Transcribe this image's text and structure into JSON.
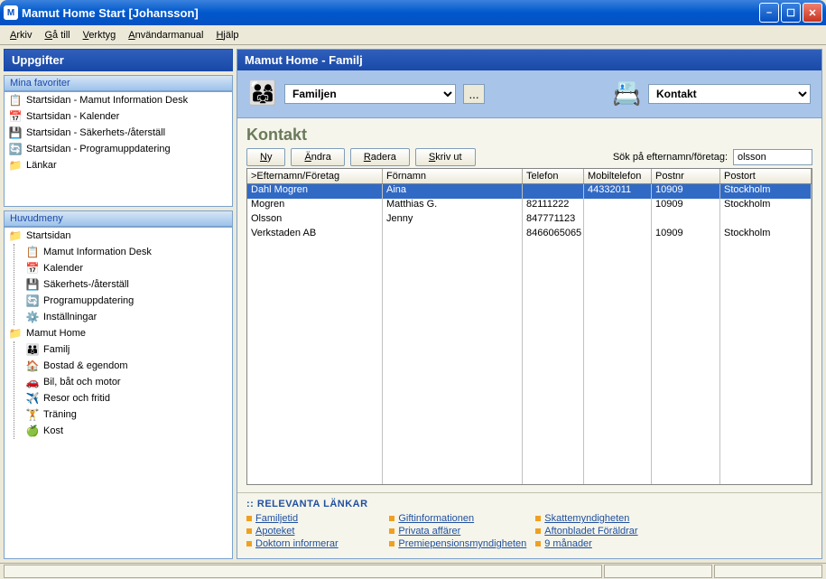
{
  "window": {
    "title": "Mamut Home Start  [Johansson]"
  },
  "menubar": [
    "Arkiv",
    "Gå till",
    "Verktyg",
    "Användarmanual",
    "Hjälp"
  ],
  "left": {
    "title": "Uppgifter",
    "favorites": {
      "header": "Mina favoriter",
      "items": [
        {
          "icon": "info",
          "label": "Startsidan - Mamut Information Desk"
        },
        {
          "icon": "calendar",
          "label": "Startsidan - Kalender"
        },
        {
          "icon": "disk",
          "label": "Startsidan - Säkerhets-/återställ"
        },
        {
          "icon": "arrow",
          "label": "Startsidan - Programuppdatering"
        },
        {
          "icon": "folder",
          "label": "Länkar"
        }
      ]
    },
    "mainmenu": {
      "header": "Huvudmeny",
      "nodes": [
        {
          "icon": "folder",
          "label": "Startsidan",
          "children": [
            {
              "icon": "info",
              "label": "Mamut Information Desk"
            },
            {
              "icon": "calendar",
              "label": "Kalender"
            },
            {
              "icon": "disk",
              "label": "Säkerhets-/återställ"
            },
            {
              "icon": "arrow",
              "label": "Programuppdatering"
            },
            {
              "icon": "gear",
              "label": "Inställningar"
            }
          ]
        },
        {
          "icon": "folder",
          "label": "Mamut Home",
          "children": [
            {
              "icon": "family",
              "label": "Familj"
            },
            {
              "icon": "home-small",
              "label": "Bostad & egendom"
            },
            {
              "icon": "car",
              "label": "Bil, båt och motor"
            },
            {
              "icon": "plane",
              "label": "Resor och fritid"
            },
            {
              "icon": "train",
              "label": "Träning"
            },
            {
              "icon": "food",
              "label": "Kost"
            }
          ]
        }
      ]
    }
  },
  "right": {
    "header": "Mamut Home - Familj",
    "selector1": "Familjen",
    "selector2": "Kontakt",
    "section_title": "Kontakt",
    "buttons": {
      "new": "Ny",
      "edit": "Ändra",
      "delete": "Radera",
      "print": "Skriv ut"
    },
    "search_label": "Sök på efternamn/företag:",
    "search_value": "olsson",
    "grid": {
      "headers": [
        ">Efternamn/Företag",
        "Förnamn",
        "Telefon",
        "Mobiltelefon",
        "Postnr",
        "Postort"
      ],
      "rows": [
        {
          "sel": true,
          "c": [
            "Dahl Mogren",
            "Aina",
            "",
            "44332011",
            "10909",
            "Stockholm"
          ]
        },
        {
          "sel": false,
          "c": [
            "Mogren",
            "Matthias G.",
            "82111222",
            "",
            "10909",
            "Stockholm"
          ]
        },
        {
          "sel": false,
          "c": [
            "Olsson",
            "Jenny",
            "847771123",
            "",
            "",
            ""
          ]
        },
        {
          "sel": false,
          "c": [
            "Verkstaden AB",
            "",
            "8466065065",
            "",
            "10909",
            "Stockholm"
          ]
        }
      ]
    },
    "links": {
      "title": ":: RELEVANTA LÄNKAR",
      "items": [
        "Familjetid",
        "Giftinformationen",
        "Skattemyndigheten",
        "",
        "Apoteket",
        "Privata affärer",
        "Aftonbladet Föräldrar",
        "",
        "Doktorn informerar",
        "Premiepensionsmyndigheten",
        "9 månader",
        ""
      ]
    }
  }
}
